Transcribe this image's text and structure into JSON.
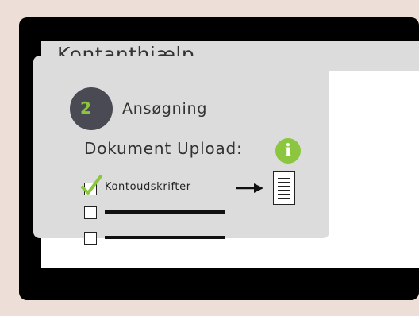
{
  "app": {
    "title": "Kontanthjælp"
  },
  "step": {
    "number": "2",
    "title": "Ansøgning"
  },
  "upload": {
    "label": "Dokument Upload:",
    "info_icon": "info-icon"
  },
  "documents": [
    {
      "label": "Kontoudskrifter",
      "checked": true
    }
  ],
  "colors": {
    "accent": "#8cc63f",
    "step_circle": "#4a4a54",
    "card": "#dcdcdc",
    "background": "#eeded8"
  }
}
